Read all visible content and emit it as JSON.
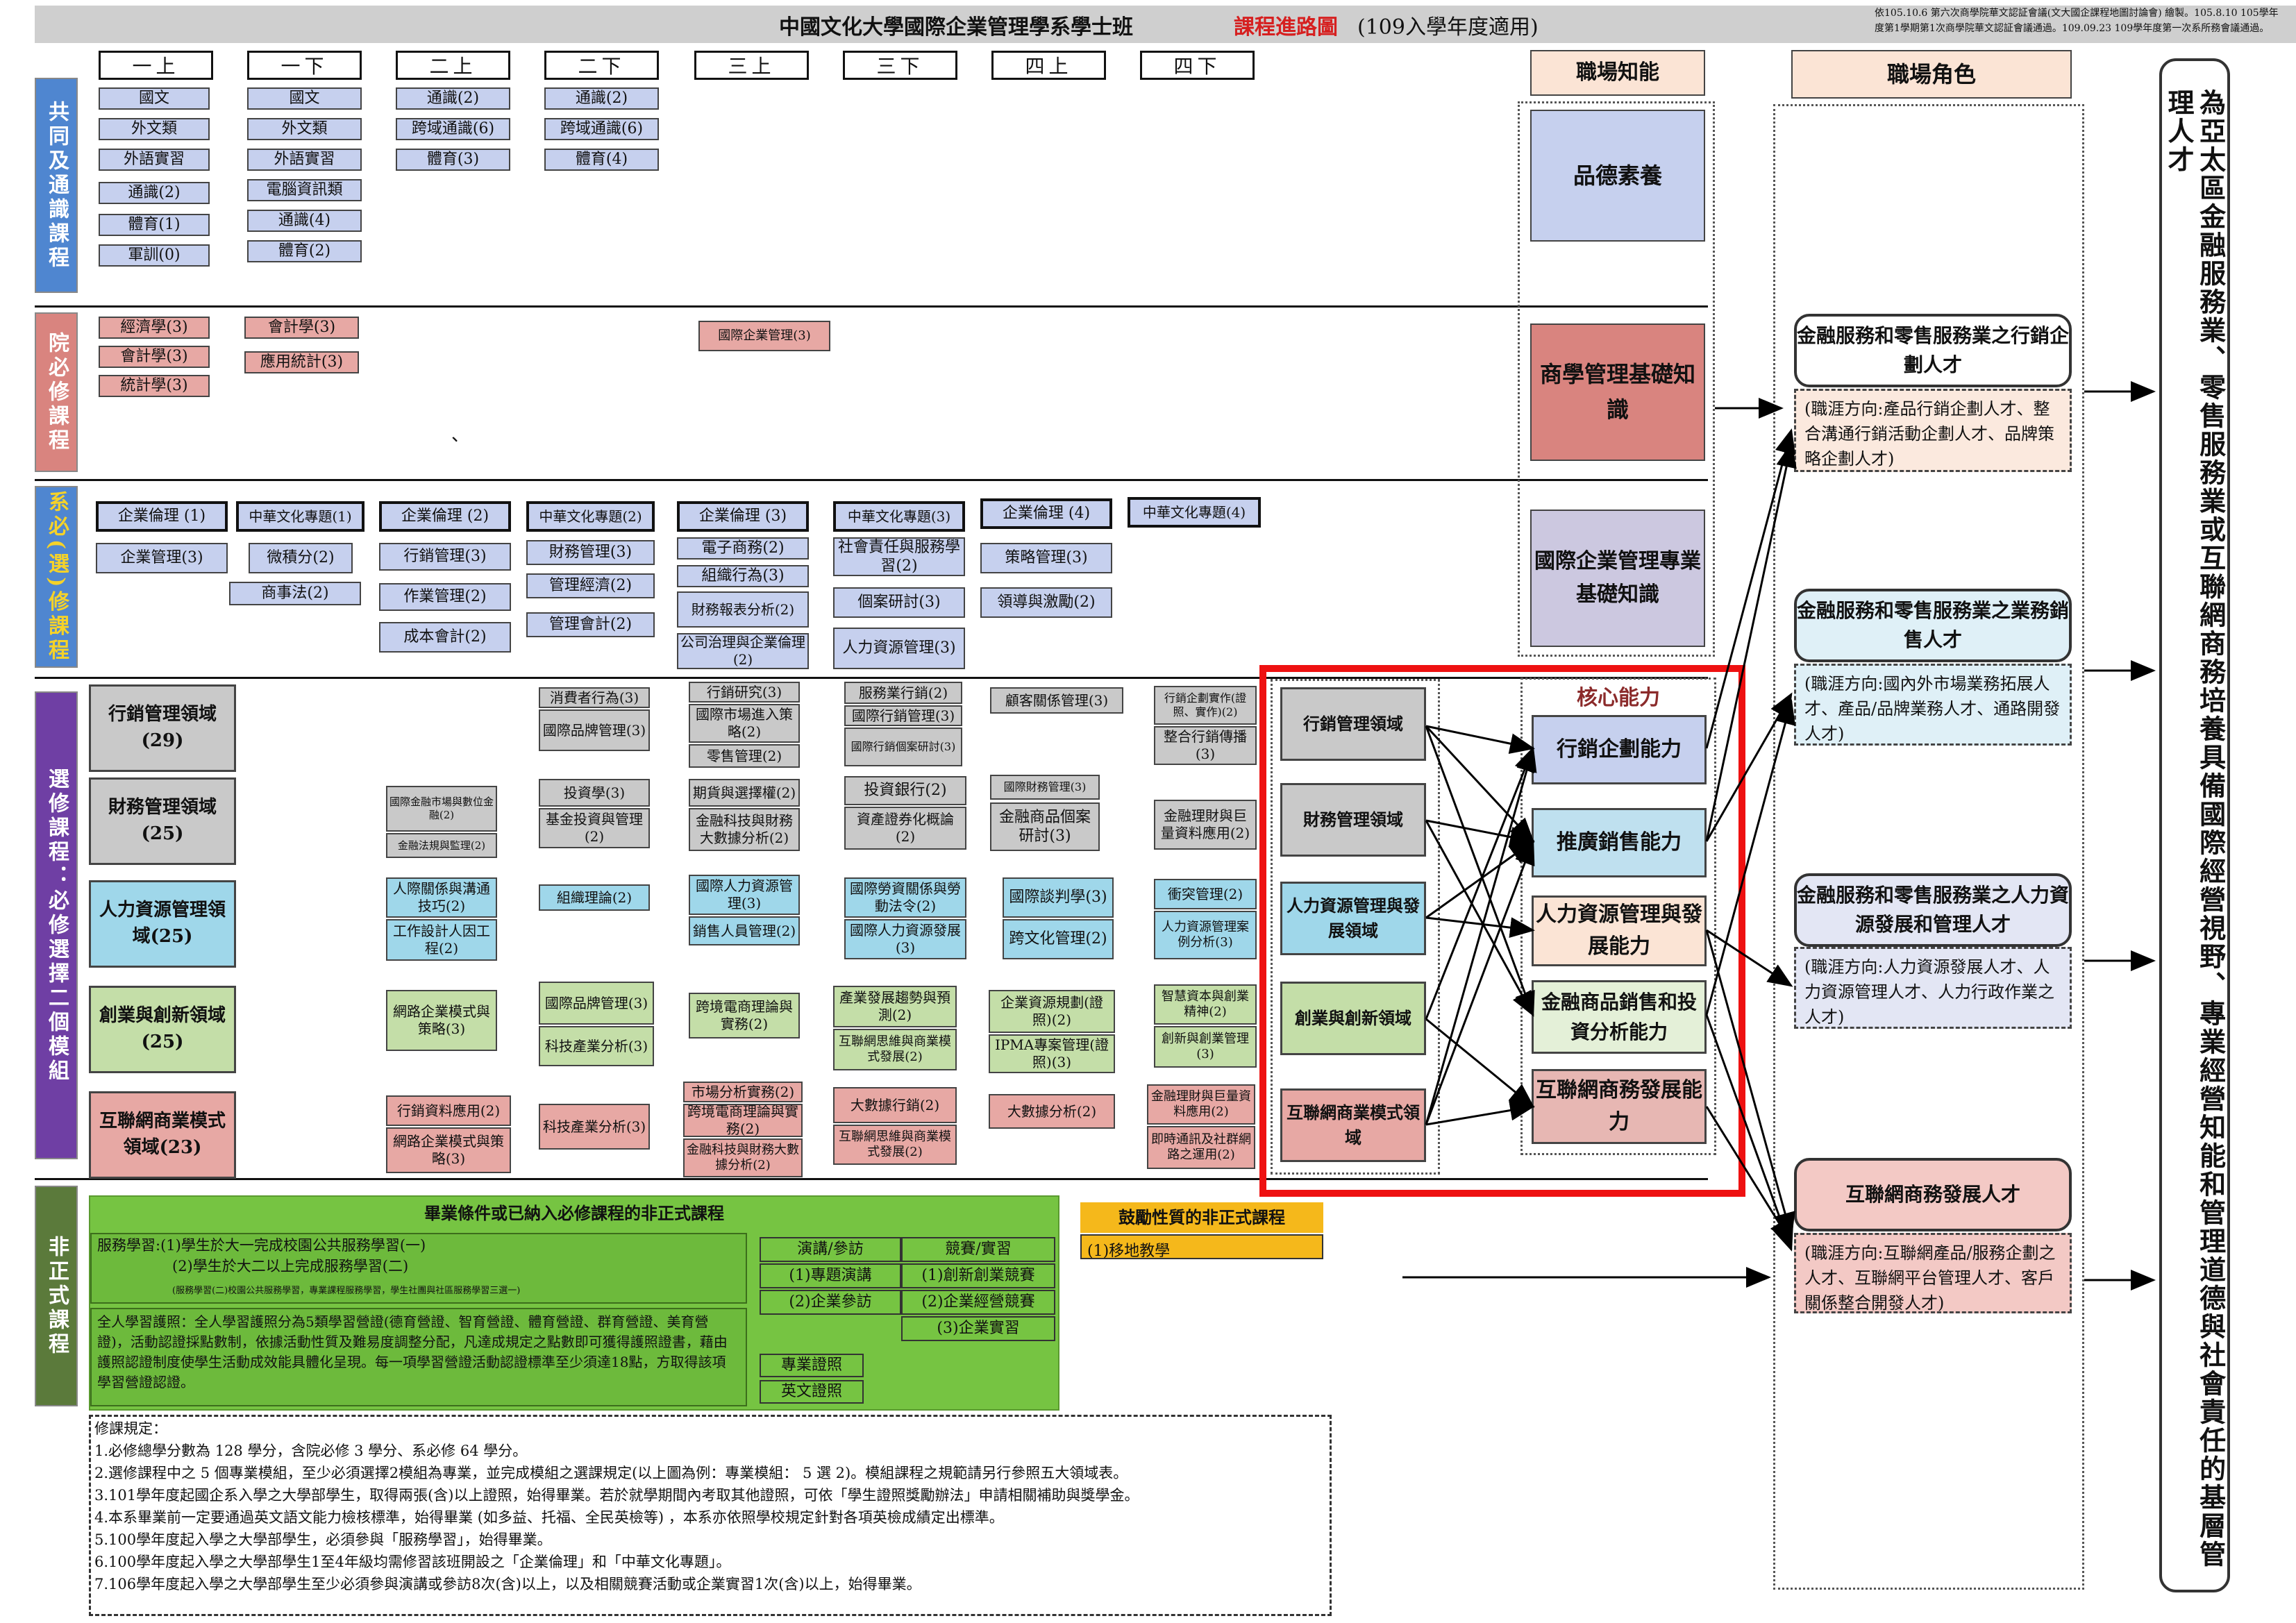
{
  "header": {
    "title": "中國文化大學國際企業管理學系學士班",
    "map_label": "課程進路圖",
    "suffix": "(109入學年度適用)",
    "note1": "依105.10.6 第六次商學院華文認証會議(文大國企課程地圖討論會) 繪製。105.8.10 105學年",
    "note2": "度第1學期第1次商學院華文認証會議通過。109.09.23 109學年度第一次系所務會議通過。"
  },
  "years": [
    "一上",
    "一下",
    "二上",
    "二下",
    "三上",
    "三下",
    "四上",
    "四下"
  ],
  "rows": {
    "general": "共同及通識課程",
    "college": "院必修課程",
    "dept": "系必(選)修課程",
    "elective": "選修課程：必修選擇二個模組",
    "informal": "非正式課程"
  },
  "general_courses": {
    "y1a": [
      "國文",
      "外文類",
      "外語實習",
      "通識(2)",
      "體育(1)",
      "軍訓(0)"
    ],
    "y1b": [
      "國文",
      "外文類",
      "外語實習",
      "電腦資訊類",
      "通識(4)",
      "體育(2)"
    ],
    "y2a": [
      "通識(2)",
      "跨域通識(6)",
      "體育(3)"
    ],
    "y2b": [
      "通識(2)",
      "跨域通識(6)",
      "體育(4)"
    ]
  },
  "college_courses": {
    "y1a": [
      "經濟學(3)",
      "會計學(3)",
      "統計學(3)"
    ],
    "y1b": [
      "會計學(3)",
      "應用統計(3)"
    ],
    "y3a": "國際企業管理(3)",
    "mark": "、"
  },
  "dept_courses": {
    "y1a": [
      "企業倫理 (1)",
      "企業管理(3)"
    ],
    "y1b": [
      "中華文化專題(1)",
      "微積分(2)",
      "商事法(2)"
    ],
    "y2a": [
      "企業倫理 (2)",
      "行銷管理(3)",
      "作業管理(2)",
      "成本會計(2)"
    ],
    "y2b": [
      "中華文化專題(2)",
      "財務管理(3)",
      "管理經濟(2)",
      "管理會計(2)"
    ],
    "y3a": [
      "企業倫理 (3)",
      "電子商務(2)",
      "組織行為(3)",
      "財務報表分析(2)",
      "公司治理與企業倫理(2)"
    ],
    "y3b": [
      "中華文化專題(3)",
      "社會責任與服務學習(2)",
      "個案研討(3)",
      "人力資源管理(3)"
    ],
    "y4a": [
      "企業倫理 (4)",
      "策略管理(3)",
      "領導與激勵(2)"
    ],
    "y4b": [
      "中華文化專題(4)"
    ]
  },
  "modules": [
    {
      "name": "行銷管理領域",
      "credits": "(29)"
    },
    {
      "name": "財務管理領域",
      "credits": "(25)"
    },
    {
      "name": "人力資源管理領域(25)",
      "credits": ""
    },
    {
      "name": "創業與創新領域(25)",
      "credits": ""
    },
    {
      "name": "互聯網商業模式領域(23)",
      "credits": ""
    }
  ],
  "elective_courses": {
    "mkt": [
      "消費者行為(3)",
      "國際品牌管理(3)",
      "行銷研究(3)",
      "國際市場進入策略(2)",
      "零售管理(2)",
      "服務業行銷(2)",
      "國際行銷管理(3)",
      "國際行銷個案研討(3)",
      "顧客關係管理(3)",
      "行銷企劃實作(證照、實作)(2)",
      "整合行銷傳播(3)"
    ],
    "fin": [
      "國際金融市場與數位金融(2)",
      "金融法規與監理(2)",
      "投資學(3)",
      "基金投資與管理(2)",
      "期貨與選擇權(2)",
      "金融科技與財務大數據分析(2)",
      "投資銀行(2)",
      "資產證券化概論(2)",
      "國際財務管理(3)",
      "金融商品個案研討(3)",
      "金融理財與巨量資料應用(2)"
    ],
    "hr": [
      "人際關係與溝通技巧(2)",
      "工作設計人因工程(2)",
      "組織理論(2)",
      "國際人力資源管理(3)",
      "銷售人員管理(2)",
      "國際勞資關係與勞動法令(2)",
      "國際人力資源發展(3)",
      "國際談判學(3)",
      "跨文化管理(2)",
      "衝突管理(2)",
      "人力資源管理案例分析(3)"
    ],
    "ent": [
      "網路企業模式與策略(3)",
      "國際品牌管理(3)",
      "科技產業分析(3)",
      "跨境電商理論與實務(2)",
      "產業發展趨勢與預測(2)",
      "互聯網思維與商業模式發展(2)",
      "企業資源規劃(證照)(2)",
      "IPMA專案管理(證照)(3)",
      "智慧資本與創業精神(2)",
      "創新與創業管理(3)"
    ],
    "net": [
      "行銷資料應用(2)",
      "網路企業模式與策略(3)",
      "科技產業分析(3)",
      "市場分析實務(2)",
      "跨境電商理論與實務(2)",
      "金融科技與財務大數據分析(2)",
      "大數據行銷(2)",
      "互聯網思維與商業模式發展(2)",
      "大數據分析(2)",
      "金融理財與巨量資料應用(2)",
      "即時通訊及社群網路之運用(2)"
    ]
  },
  "informal": {
    "grad_title": "畢業條件或已納入必修課程的非正式課程",
    "service1": "服務學習:(1)學生於大一完成校園公共服務學習(一)",
    "service2": "(2)學生於大二以上完成服務學習(二)",
    "service_small": "(服務學習(二)校園公共服務學習，專業課程服務學習，學生社團與社區服務學習三選一)",
    "portfolio": "全人學習護照：全人學習護照分為5類學習營證(德育營證、智育營證、體育營證、群育營證、美育營證)，活動認證採點數制，依據活動性質及難易度調整分配，凡達成規定之點數即可獲得護照證書，藉由護照認證制度使學生活動成效能具體化呈現。每一項學習營證活動認證標準至少須達18點，方取得該項學習營證認證。",
    "t_speech": "演講/參訪",
    "t_comp": "競賽/實習",
    "speech": [
      "(1)專題演講",
      "(2)企業參訪"
    ],
    "comp": [
      "(1)創新創業競賽",
      "(2)企業經營競賽",
      "(3)企業實習"
    ],
    "cert": [
      "專業證照",
      "英文證照"
    ],
    "enc_title": "鼓勵性質的非正式課程",
    "enc_item": "(1)移地教學"
  },
  "rules": [
    "修課規定：",
    "1.必修總學分數為 128 學分，含院必修 3 學分、系必修 64 學分。",
    "2.選修課程中之 5 個專業模組，至少必須選擇2模組為專業，並完成模組之選課規定(以上圖為例：專業模組： 5 選 2)。模組課程之規範請另行參照五大領域表。",
    "3.101學年度起國企系入學之大學部學生，取得兩張(含)以上證照，始得畢業。若於就學期間內考取其他證照，可依「學生證照獎勵辦法」申請相關補助與獎學金。",
    "4.本系畢業前一定要通過英文語文能力檢核標準，始得畢業 (如多益、托福、全民英檢等) ，本系亦依照學校規定針對各項英檢成績定出標準。",
    "5.100學年度起入學之大學部學生，必須參與「服務學習」，始得畢業。",
    "6.100學年度起入學之大學部學生1至4年級均需修習該班開設之「企業倫理」和「中華文化專題」。",
    "7.106學年度起入學之大學部學生至少必須參與演講或參訪8次(含)以上，以及相關競賽活動或企業實習1次(含)以上，始得畢業。"
  ],
  "workplace": {
    "title": "職場知能",
    "items": [
      "品德素養",
      "商學管理基礎知識",
      "國際企業管理專業基礎知識"
    ]
  },
  "core": {
    "title": "核心能力",
    "modules": [
      "行銷管理領域",
      "財務管理領域",
      "人力資源管理與發展領域",
      "創業與創新領域",
      "互聯網商業模式領域"
    ],
    "skills": [
      "行銷企劃能力",
      "推廣銷售能力",
      "人力資源管理與發展能力",
      "金融商品銷售和投資分析能力",
      "互聯網商務發展能力"
    ]
  },
  "roles": {
    "title": "職場角色",
    "items": [
      {
        "name": "金融服務和零售服務業之行銷企劃人才",
        "desc": "(職涯方向:產品行銷企劃人才、整合溝通行銷活動企劃人才、品牌策略企劃人才)"
      },
      {
        "name": "金融服務和零售服務業之業務銷售人才",
        "desc": "(職涯方向:國內外市場業務拓展人才、產品/品牌業務人才、通路開發人才)"
      },
      {
        "name": "金融服務和零售服務業之人力資源發展和管理人才",
        "desc": "(職涯方向:人力資源發展人才、人力資源管理人才、人力行政作業之人才)"
      },
      {
        "name": "互聯網商務發展人才",
        "desc": "(職涯方向:互聯網產品/服務企劃之人才、互聯網平台管理人才、客戶關係整合開發人才)"
      }
    ]
  },
  "vision": "為亞太區金融服務業、零售服務業或互聯網商務培養具備國際經營視野、專業經營知能和管理道德與社會責任的基層管理人才",
  "colors": {
    "title_red": "#d62020",
    "highlight": "#ee1111",
    "label_blue": "#4f86d0",
    "label_red": "#d9847f",
    "label_yellow": "#4f86d0",
    "label_purple": "#6f3fa4",
    "label_green": "#5b7a3b",
    "green": "#76c442",
    "yellow": "#f5b81b"
  }
}
